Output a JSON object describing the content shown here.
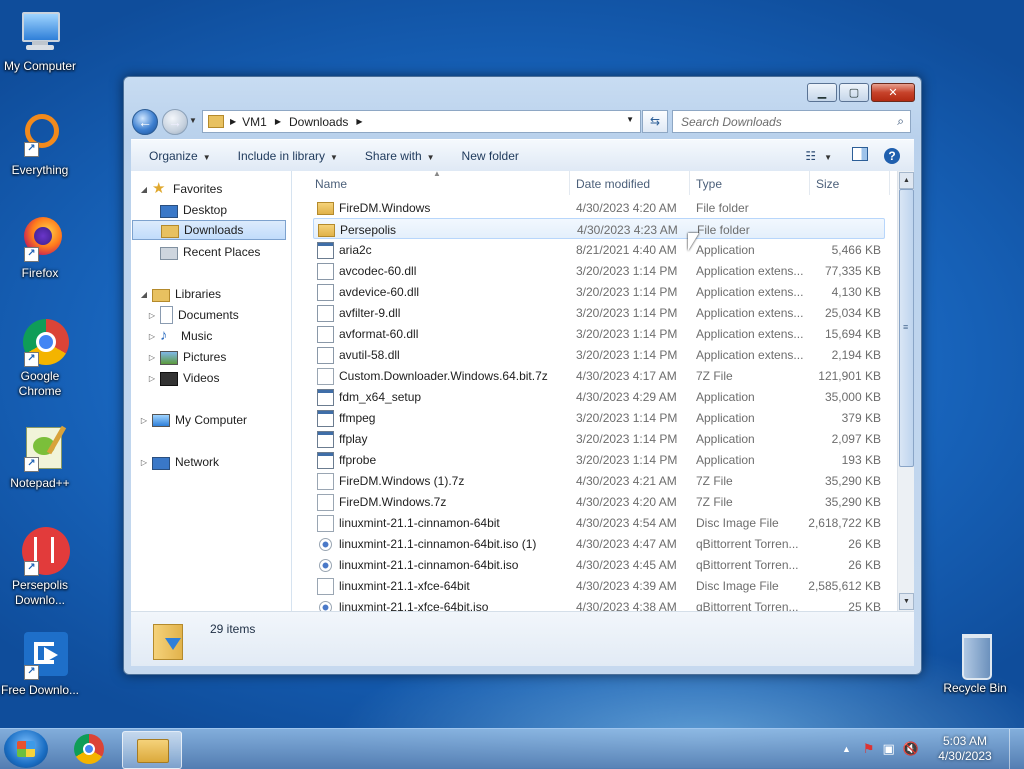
{
  "desktop": {
    "icons": [
      {
        "label": "My Computer"
      },
      {
        "label": "Everything"
      },
      {
        "label": "Firefox"
      },
      {
        "label": "Google Chrome"
      },
      {
        "label": "Notepad++"
      },
      {
        "label": "Persepolis Downlo..."
      },
      {
        "label": "Free Downlo..."
      },
      {
        "label": "Recycle Bin"
      }
    ]
  },
  "window": {
    "address": {
      "segments": [
        "VM1",
        "Downloads"
      ]
    },
    "search": {
      "placeholder": "Search Downloads"
    },
    "toolbar": {
      "organize": "Organize",
      "include": "Include in library",
      "share": "Share with",
      "new_folder": "New folder"
    },
    "nav": {
      "favorites": "Favorites",
      "desktop": "Desktop",
      "downloads": "Downloads",
      "recent": "Recent Places",
      "libraries": "Libraries",
      "documents": "Documents",
      "music": "Music",
      "pictures": "Pictures",
      "videos": "Videos",
      "computer": "My Computer",
      "network": "Network"
    },
    "columns": {
      "name": "Name",
      "date": "Date modified",
      "type": "Type",
      "size": "Size"
    },
    "files": [
      {
        "name": "FireDM.Windows",
        "date": "4/30/2023 4:20 AM",
        "type": "File folder",
        "size": ""
      },
      {
        "name": "Persepolis",
        "date": "4/30/2023 4:23 AM",
        "type": "File folder",
        "size": ""
      },
      {
        "name": "aria2c",
        "date": "8/21/2021 4:40 AM",
        "type": "Application",
        "size": "5,466 KB"
      },
      {
        "name": "avcodec-60.dll",
        "date": "3/20/2023 1:14 PM",
        "type": "Application extens...",
        "size": "77,335 KB"
      },
      {
        "name": "avdevice-60.dll",
        "date": "3/20/2023 1:14 PM",
        "type": "Application extens...",
        "size": "4,130 KB"
      },
      {
        "name": "avfilter-9.dll",
        "date": "3/20/2023 1:14 PM",
        "type": "Application extens...",
        "size": "25,034 KB"
      },
      {
        "name": "avformat-60.dll",
        "date": "3/20/2023 1:14 PM",
        "type": "Application extens...",
        "size": "15,694 KB"
      },
      {
        "name": "avutil-58.dll",
        "date": "3/20/2023 1:14 PM",
        "type": "Application extens...",
        "size": "2,194 KB"
      },
      {
        "name": "Custom.Downloader.Windows.64.bit.7z",
        "date": "4/30/2023 4:17 AM",
        "type": "7Z File",
        "size": "121,901 KB"
      },
      {
        "name": "fdm_x64_setup",
        "date": "4/30/2023 4:29 AM",
        "type": "Application",
        "size": "35,000 KB"
      },
      {
        "name": "ffmpeg",
        "date": "3/20/2023 1:14 PM",
        "type": "Application",
        "size": "379 KB"
      },
      {
        "name": "ffplay",
        "date": "3/20/2023 1:14 PM",
        "type": "Application",
        "size": "2,097 KB"
      },
      {
        "name": "ffprobe",
        "date": "3/20/2023 1:14 PM",
        "type": "Application",
        "size": "193 KB"
      },
      {
        "name": "FireDM.Windows (1).7z",
        "date": "4/30/2023 4:21 AM",
        "type": "7Z File",
        "size": "35,290 KB"
      },
      {
        "name": "FireDM.Windows.7z",
        "date": "4/30/2023 4:20 AM",
        "type": "7Z File",
        "size": "35,290 KB"
      },
      {
        "name": "linuxmint-21.1-cinnamon-64bit",
        "date": "4/30/2023 4:54 AM",
        "type": "Disc Image File",
        "size": "2,618,722 KB"
      },
      {
        "name": "linuxmint-21.1-cinnamon-64bit.iso (1)",
        "date": "4/30/2023 4:47 AM",
        "type": "qBittorrent Torren...",
        "size": "26 KB"
      },
      {
        "name": "linuxmint-21.1-cinnamon-64bit.iso",
        "date": "4/30/2023 4:45 AM",
        "type": "qBittorrent Torren...",
        "size": "26 KB"
      },
      {
        "name": "linuxmint-21.1-xfce-64bit",
        "date": "4/30/2023 4:39 AM",
        "type": "Disc Image File",
        "size": "2,585,612 KB"
      },
      {
        "name": "linuxmint-21.1-xfce-64bit.iso",
        "date": "4/30/2023 4:38 AM",
        "type": "qBittorrent Torren...",
        "size": "25 KB"
      }
    ],
    "status": {
      "count": "29 items"
    }
  },
  "taskbar": {
    "time": "5:03 AM",
    "date": "4/30/2023"
  }
}
